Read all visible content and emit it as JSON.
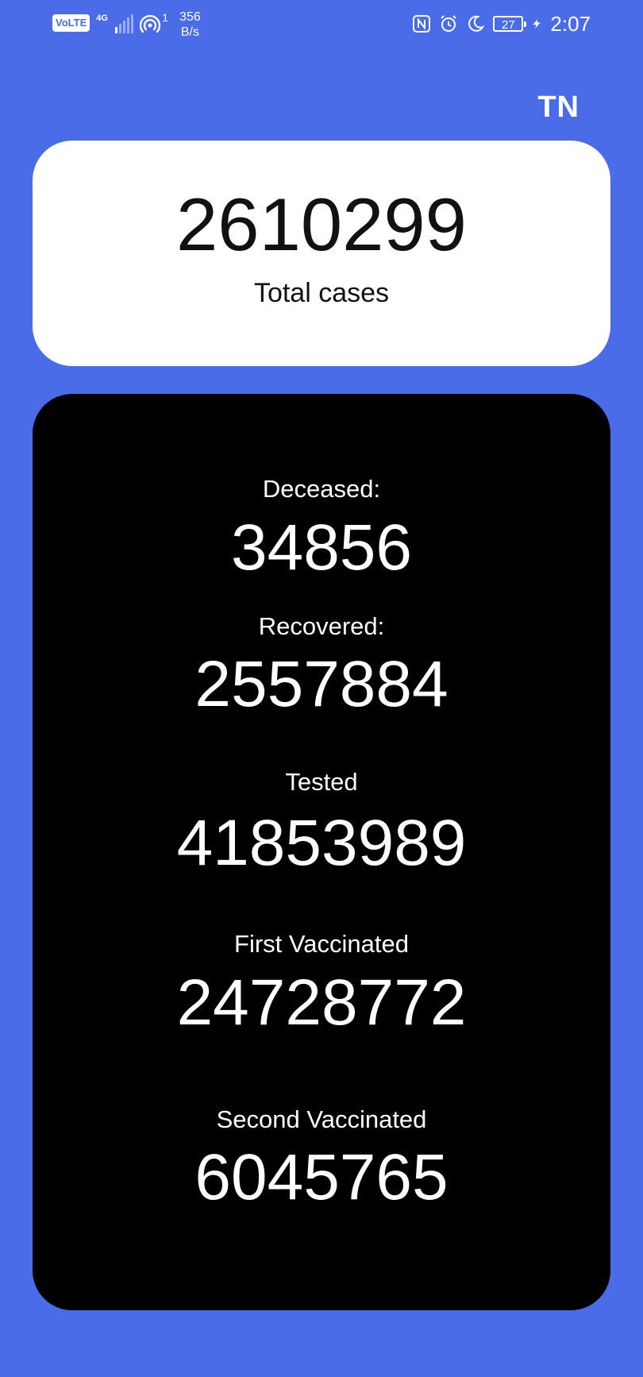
{
  "status_bar": {
    "volte": "VoLTE",
    "network": "4G",
    "hotspot_count": "1",
    "speed_value": "356",
    "speed_unit": "B/s",
    "battery": "27",
    "time": "2:07",
    "icons": [
      "nfc-icon",
      "alarm-icon",
      "do-not-disturb-moon-icon",
      "charging-bolt-icon"
    ]
  },
  "header": {
    "region_code": "TN"
  },
  "total": {
    "value": "2610299",
    "label": "Total cases"
  },
  "stats": {
    "deceased": {
      "label": "Deceased:",
      "value": "34856"
    },
    "recovered": {
      "label": "Recovered:",
      "value": "2557884"
    },
    "tested": {
      "label": "Tested",
      "value": "41853989"
    },
    "first_vaccinated": {
      "label": "First Vaccinated",
      "value": "24728772"
    },
    "second_vaccinated": {
      "label": "Second Vaccinated",
      "value": "6045765"
    }
  },
  "colors": {
    "background": "#4A6CE8",
    "total_card": "#FFFFFF",
    "stats_card": "#000000"
  }
}
